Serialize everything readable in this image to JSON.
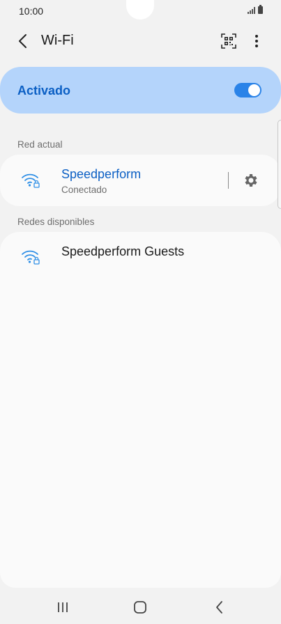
{
  "status_bar": {
    "time": "10:00"
  },
  "header": {
    "title": "Wi-Fi"
  },
  "wifi_toggle": {
    "label": "Activado",
    "state": "on"
  },
  "current_network": {
    "section_label": "Red actual",
    "name": "Speedperform",
    "status": "Conectado"
  },
  "available_networks": {
    "section_label": "Redes disponibles",
    "items": [
      {
        "name": "Speedperform Guests"
      }
    ]
  },
  "colors": {
    "accent": "#0b5fc4",
    "toggle_card_bg": "#b4d4fb",
    "switch_on": "#2a83e8",
    "wifi_icon": "#2f8fe6"
  }
}
